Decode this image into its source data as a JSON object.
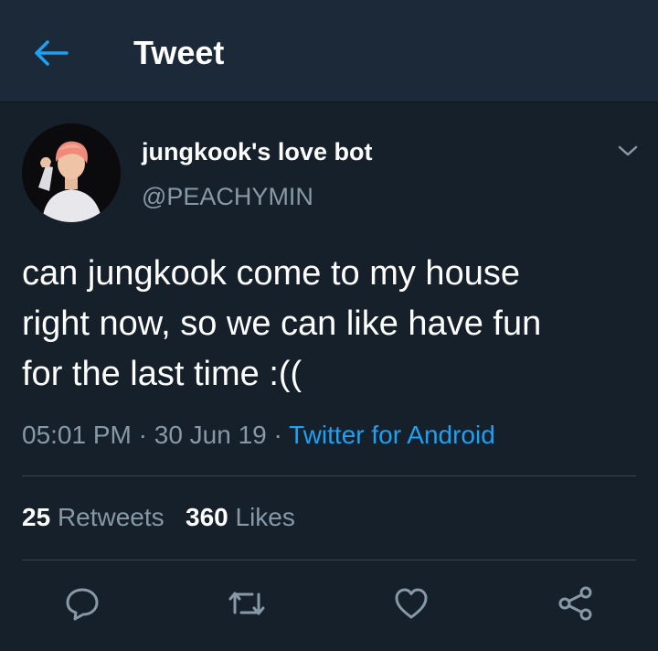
{
  "header": {
    "back_icon": "arrow-left-icon",
    "title": "Tweet"
  },
  "tweet": {
    "display_name": "jungkook's love bot",
    "handle": "@PEACHYMIN",
    "text": "can jungkook come to my house\nright now, so we can like have fun\nfor the last time :((",
    "time": "05:01 PM",
    "date": "30 Jun 19",
    "separator": "·",
    "source": "Twitter for Android",
    "more_icon": "chevron-down-icon"
  },
  "stats": {
    "retweets_count": "25",
    "retweets_label": "Retweets",
    "likes_count": "360",
    "likes_label": "Likes"
  },
  "actions": [
    {
      "name": "reply",
      "icon": "reply-icon"
    },
    {
      "name": "retweet",
      "icon": "retweet-icon"
    },
    {
      "name": "like",
      "icon": "heart-icon"
    },
    {
      "name": "share",
      "icon": "share-icon"
    }
  ],
  "colors": {
    "background": "#15202b",
    "header_background": "#1c2938",
    "accent": "#1da1f2",
    "secondary_text": "#8899a6",
    "divider": "#38444d"
  }
}
